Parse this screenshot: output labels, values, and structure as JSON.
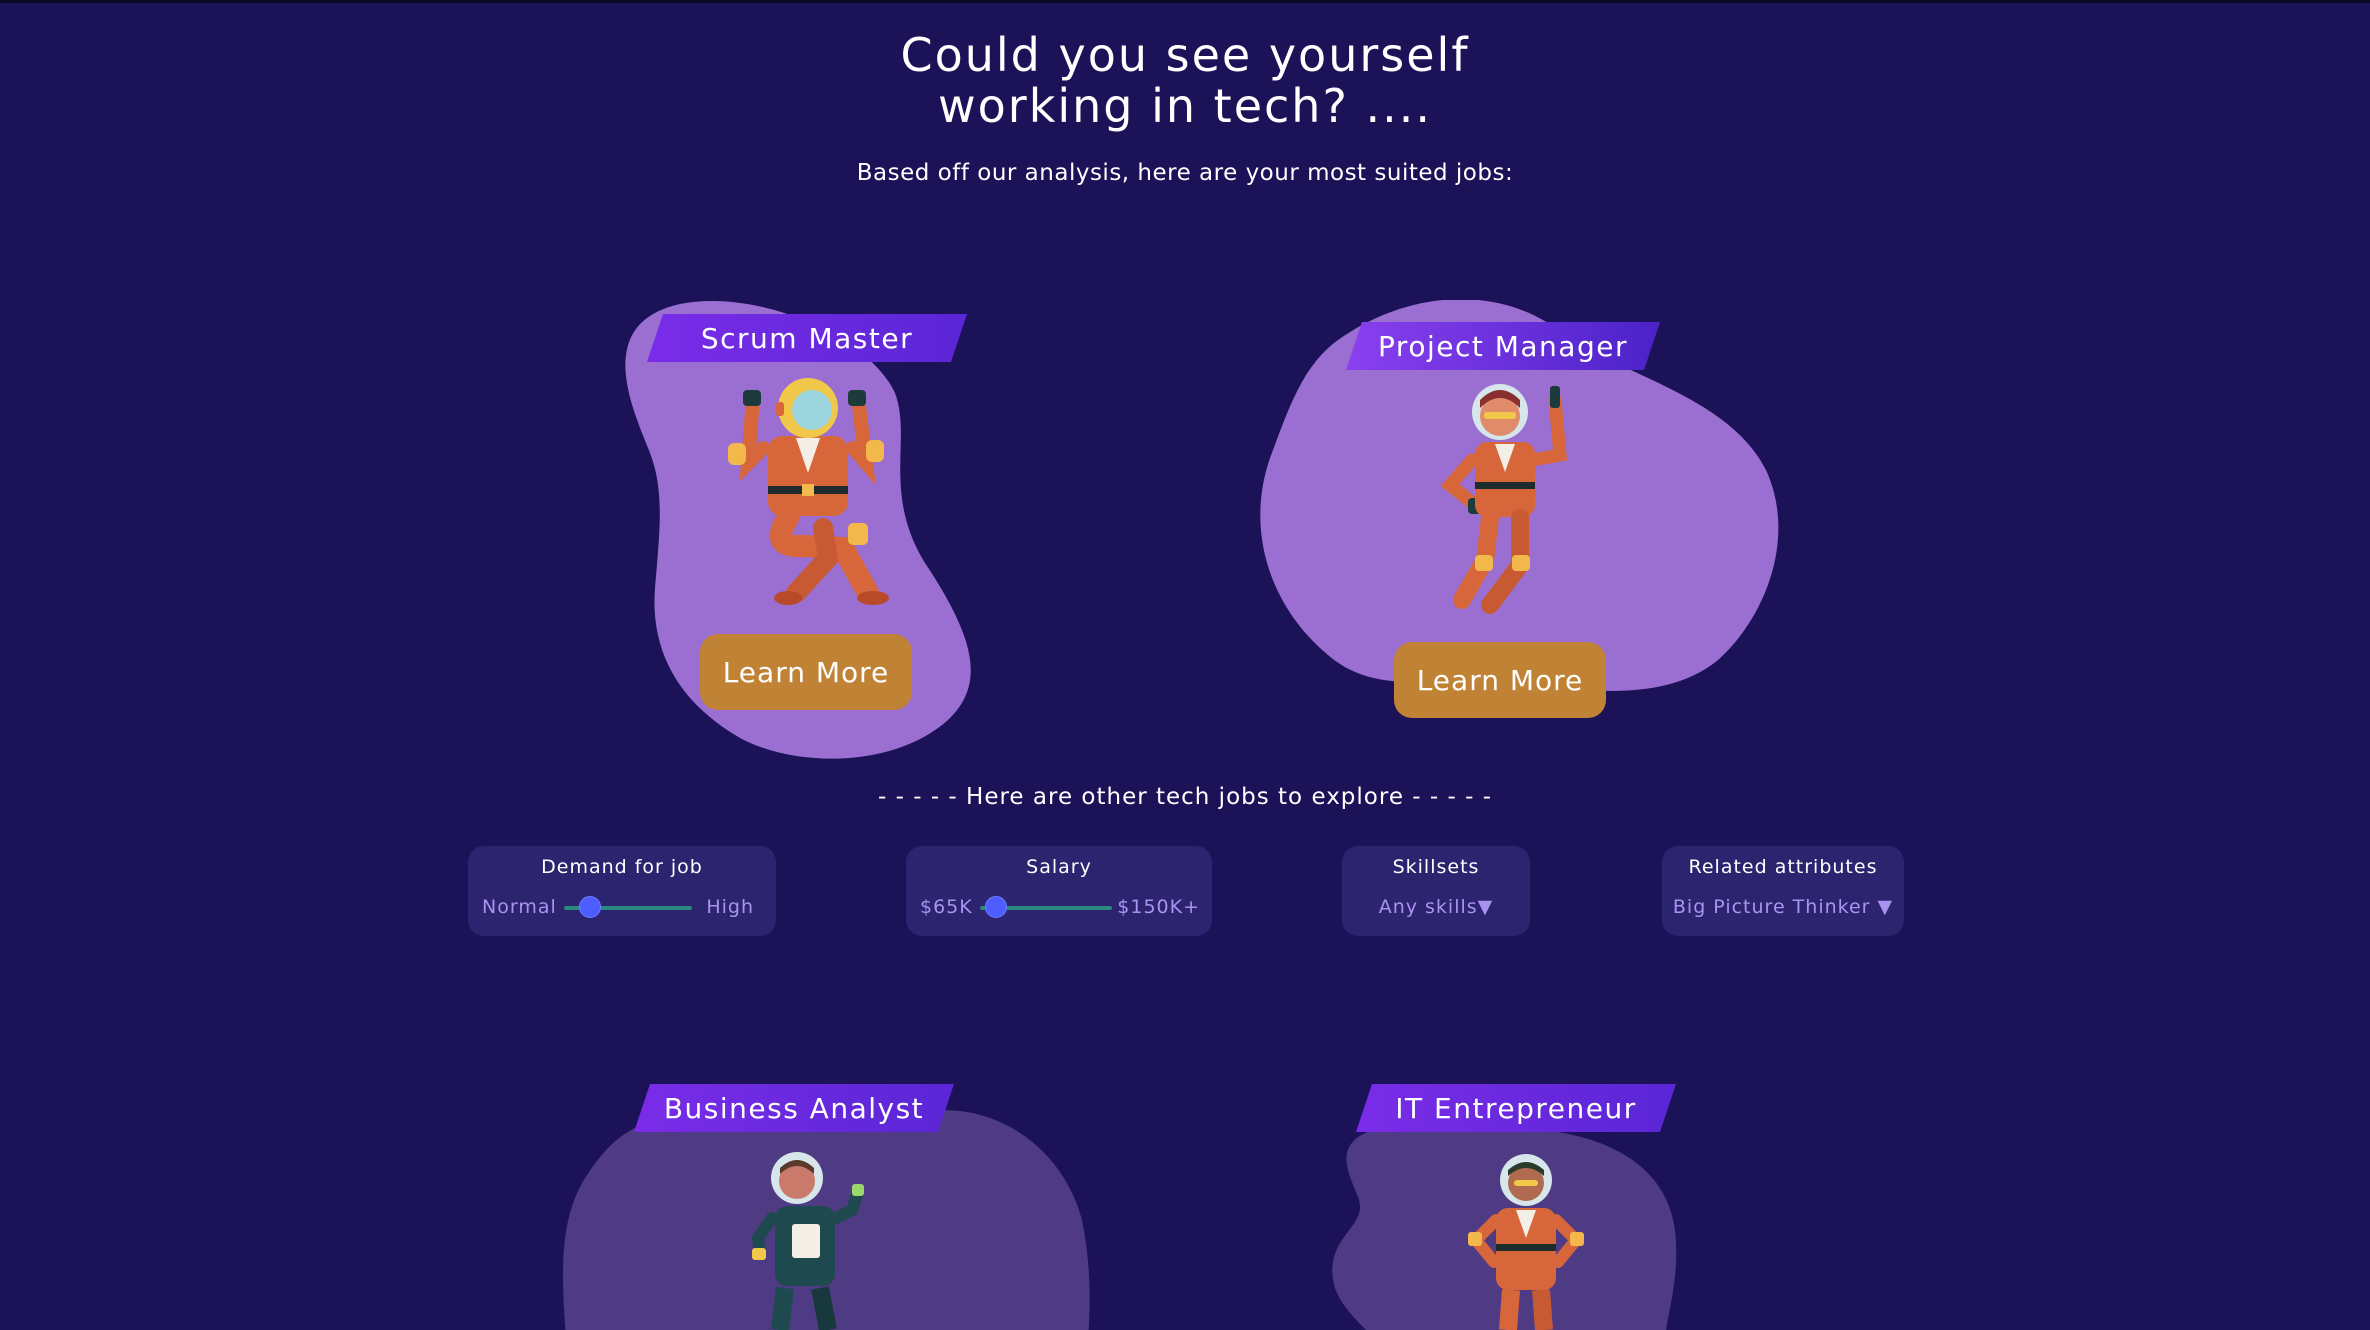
{
  "header": {
    "title_line1": "Could you see yourself",
    "title_line2": "working in tech? ....",
    "subtitle": "Based off our analysis, here are your most suited jobs:"
  },
  "top_jobs": [
    {
      "title": "Scrum Master",
      "button": "Learn More",
      "icon": "astronaut-cheering-icon"
    },
    {
      "title": "Project Manager",
      "button": "Learn More",
      "icon": "astronaut-pointing-icon"
    }
  ],
  "divider": "- - - - - Here are other tech jobs to explore - - - - -",
  "filters": {
    "demand": {
      "title": "Demand for job",
      "low": "Normal",
      "high": "High",
      "level": 0.2
    },
    "salary": {
      "title": "Salary",
      "low": "$65K",
      "high": "$150K+",
      "level": 0.12
    },
    "skills": {
      "title": "Skillsets",
      "value": "Any skills▼"
    },
    "attributes": {
      "title": "Related attributes",
      "value": "Big Picture Thinker ▼"
    }
  },
  "other_jobs": [
    {
      "title": "Business Analyst",
      "icon": "astronaut-green-suit-icon"
    },
    {
      "title": "IT Entrepreneur",
      "icon": "astronaut-hands-on-hips-icon"
    }
  ],
  "colors": {
    "background": "#1b1257",
    "blob_highlight": "#9b6fd2",
    "blob_muted": "#4f3a84",
    "button": "#c08335",
    "tag": "#7a2ce8",
    "filter_bg": "#2d2470",
    "slider_thumb": "#4d5dff",
    "slider_track": "#2b8a7d"
  }
}
